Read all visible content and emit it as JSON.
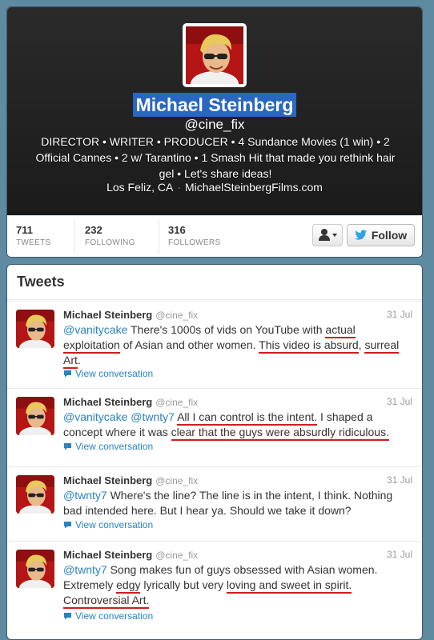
{
  "profile": {
    "name": "Michael Steinberg",
    "handle": "@cine_fix",
    "bio": "DIRECTOR • WRITER • PRODUCER • 4 Sundance Movies (1 win) • 2 Official Cannes • 2 w/ Tarantino • 1 Smash Hit that made you rethink hair gel • Let's share ideas!",
    "location": "Los Feliz, CA",
    "website": "MichaelSteinbergFilms.com",
    "location_separator": "·"
  },
  "stats": {
    "tweets": {
      "value": "711",
      "label": "TWEETS"
    },
    "following": {
      "value": "232",
      "label": "FOLLOWING"
    },
    "followers": {
      "value": "316",
      "label": "FOLLOWERS"
    }
  },
  "actions": {
    "follow_label": "Follow"
  },
  "tweets_section": {
    "title": "Tweets",
    "items": [
      {
        "name": "Michael Steinberg",
        "handle": "@cine_fix",
        "date": "31 Jul",
        "segments": [
          {
            "t": "@vanitycake",
            "mention": true
          },
          {
            "t": " There's 1000s of vids on YouTube with "
          },
          {
            "t": "actual exploitation",
            "ul": true
          },
          {
            "t": " of Asian and other women. "
          },
          {
            "t": "This video is absurd",
            "ul": true
          },
          {
            "t": ", "
          },
          {
            "t": "surreal Art",
            "ul": true
          },
          {
            "t": "."
          }
        ],
        "conversation_label": "View conversation"
      },
      {
        "name": "Michael Steinberg",
        "handle": "@cine_fix",
        "date": "31 Jul",
        "segments": [
          {
            "t": "@vanitycake",
            "mention": true
          },
          {
            "t": " "
          },
          {
            "t": "@twnty7",
            "mention": true
          },
          {
            "t": " "
          },
          {
            "t": "All I can control is the intent.",
            "ul": true
          },
          {
            "t": " I shaped a concept where it was "
          },
          {
            "t": "clear that the guys were absurdly ridiculous.",
            "ul": true
          }
        ],
        "conversation_label": "View conversation"
      },
      {
        "name": "Michael Steinberg",
        "handle": "@cine_fix",
        "date": "31 Jul",
        "segments": [
          {
            "t": "@twnty7",
            "mention": true
          },
          {
            "t": " Where's the line? The line is in the intent, I think. Nothing bad intended here.  But I hear ya. Should we take it down?"
          }
        ],
        "conversation_label": "View conversation"
      },
      {
        "name": "Michael Steinberg",
        "handle": "@cine_fix",
        "date": "31 Jul",
        "segments": [
          {
            "t": "@twnty7",
            "mention": true
          },
          {
            "t": " Song makes fun of guys obsessed with Asian women. Extremely "
          },
          {
            "t": "edgy",
            "ul": true
          },
          {
            "t": " lyrically but very "
          },
          {
            "t": "loving and sweet in spirit.",
            "ul": true
          },
          {
            "t": " "
          },
          {
            "t": "Controversial Art.",
            "ul": true
          }
        ],
        "conversation_label": "View conversation"
      }
    ]
  },
  "colors": {
    "page_bg": "#5e8aa2",
    "header_bg": "#1f1f1f",
    "name_highlight": "#2a67c0",
    "link": "#2a82c2",
    "annotation_underline": "#cc1f1f"
  },
  "icons": {
    "user_menu": "person-dropdown-icon",
    "follow": "twitter-bird-icon",
    "conversation": "speech-bubble-icon"
  }
}
